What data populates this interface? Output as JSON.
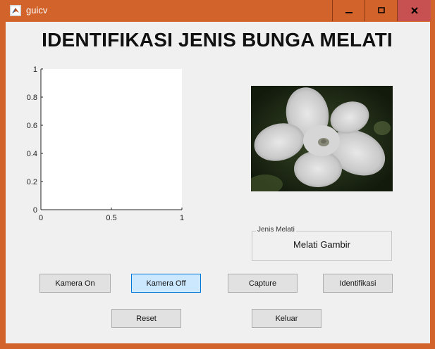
{
  "window": {
    "title": "guicv",
    "controls": {
      "minimize": "▬",
      "maximize": "▢",
      "close": "x"
    }
  },
  "main": {
    "heading": "IDENTIFIKASI JENIS BUNGA MELATI"
  },
  "axes": {
    "y_ticks": [
      "1",
      "0.8",
      "0.6",
      "0.4",
      "0.2",
      "0"
    ],
    "x_ticks": [
      "0",
      "0.5",
      "1"
    ]
  },
  "chart_data": {
    "type": "scatter",
    "x": [],
    "y": [],
    "xlim": [
      0,
      1
    ],
    "ylim": [
      0,
      1
    ],
    "xticks": [
      "0",
      "0.5",
      "1"
    ],
    "yticks": [
      "0",
      "0.2",
      "0.4",
      "0.6",
      "0.8",
      "1"
    ],
    "grid": false
  },
  "result": {
    "group_title": "Jenis Melati",
    "value": "Melati Gambir"
  },
  "buttons": {
    "kamera_on": "Kamera On",
    "kamera_off": "Kamera Off",
    "capture": "Capture",
    "identifikasi": "Identifikasi",
    "reset": "Reset",
    "keluar": "Keluar"
  },
  "colors": {
    "window_frame": "#d2632a",
    "panel": "#f0f0f0",
    "button_active": "#cce8ff"
  }
}
